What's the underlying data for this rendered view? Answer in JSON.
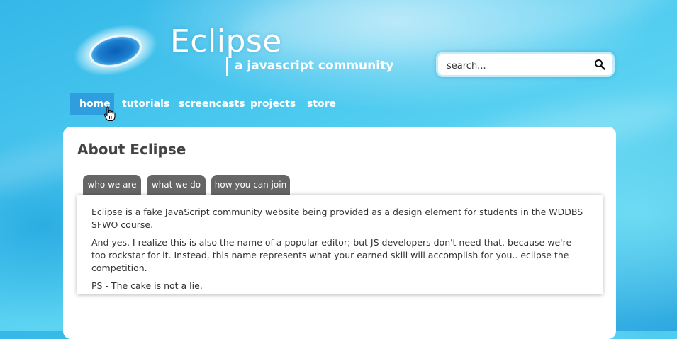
{
  "brand": {
    "title": "Eclipse",
    "subtitle": "a javascript community"
  },
  "search": {
    "placeholder": "search...",
    "value": "",
    "icon": "search-icon"
  },
  "nav": {
    "items": [
      {
        "label": "home",
        "active": true
      },
      {
        "label": "tutorials",
        "active": false
      },
      {
        "label": "screencasts",
        "active": false
      },
      {
        "label": "projects",
        "active": false
      },
      {
        "label": "store",
        "active": false
      }
    ]
  },
  "main": {
    "title": "About Eclipse",
    "tabs": [
      {
        "label": "who we are"
      },
      {
        "label": "what we do"
      },
      {
        "label": "how you can join"
      }
    ],
    "paragraphs": [
      "Eclipse is a fake JavaScript community website being provided as a design element for students in the WDDBS SFWO course.",
      "And yes, I realize this is also the name of a popular editor; but JS developers don't need that, because we're too rockstar for it. Instead, this name represents what your earned skill will accomplish for you.. eclipse the competition.",
      "PS - The cake is not a lie."
    ]
  },
  "colors": {
    "nav_active": "#2f9ede",
    "tab_bg": "#666666",
    "heading": "#444444"
  }
}
